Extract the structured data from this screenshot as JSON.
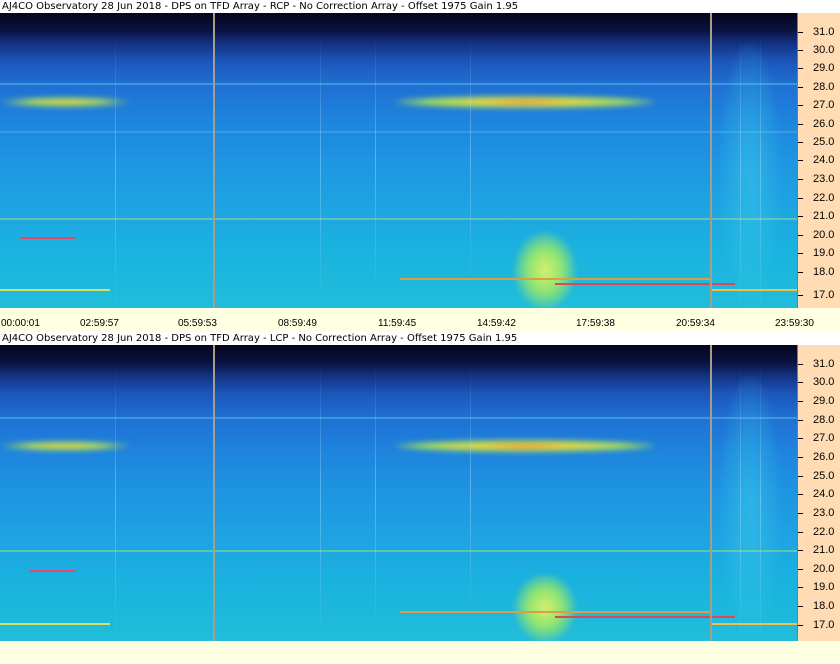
{
  "panels": [
    {
      "title": "AJ4CO Observatory 28 Jun 2018 - DPS on TFD Array  - RCP  -  No Correction Array  -  Offset 1975  Gain 1.95",
      "y_labels": [
        "31.0",
        "30.0",
        "29.0",
        "28.0",
        "27.0",
        "26.0",
        "25.0",
        "24.0",
        "23.0",
        "22.0",
        "21.0",
        "20.0",
        "19.0",
        "18.0",
        "17.0"
      ],
      "x_labels": [
        "00:00:01",
        "02:59:57",
        "05:59:53",
        "08:59:49",
        "11:59:45",
        "14:59:42",
        "17:59:38",
        "20:59:34",
        "23:59:30"
      ]
    },
    {
      "title": "AJ4CO Observatory 28 Jun 2018 - DPS on TFD Array  - LCP  -  No Correction Array  -  Offset 1975  Gain 1.95",
      "y_labels": [
        "31.0",
        "30.0",
        "29.0",
        "28.0",
        "27.0",
        "26.0",
        "25.0",
        "24.0",
        "23.0",
        "22.0",
        "21.0",
        "20.0",
        "19.0",
        "18.0",
        "17.0"
      ]
    }
  ],
  "colors": {
    "axis_background": "#ffdcb4",
    "time_axis_background": "#ffffe1",
    "marker_line": "#a89e86",
    "band_hot": "#f0c040"
  }
}
